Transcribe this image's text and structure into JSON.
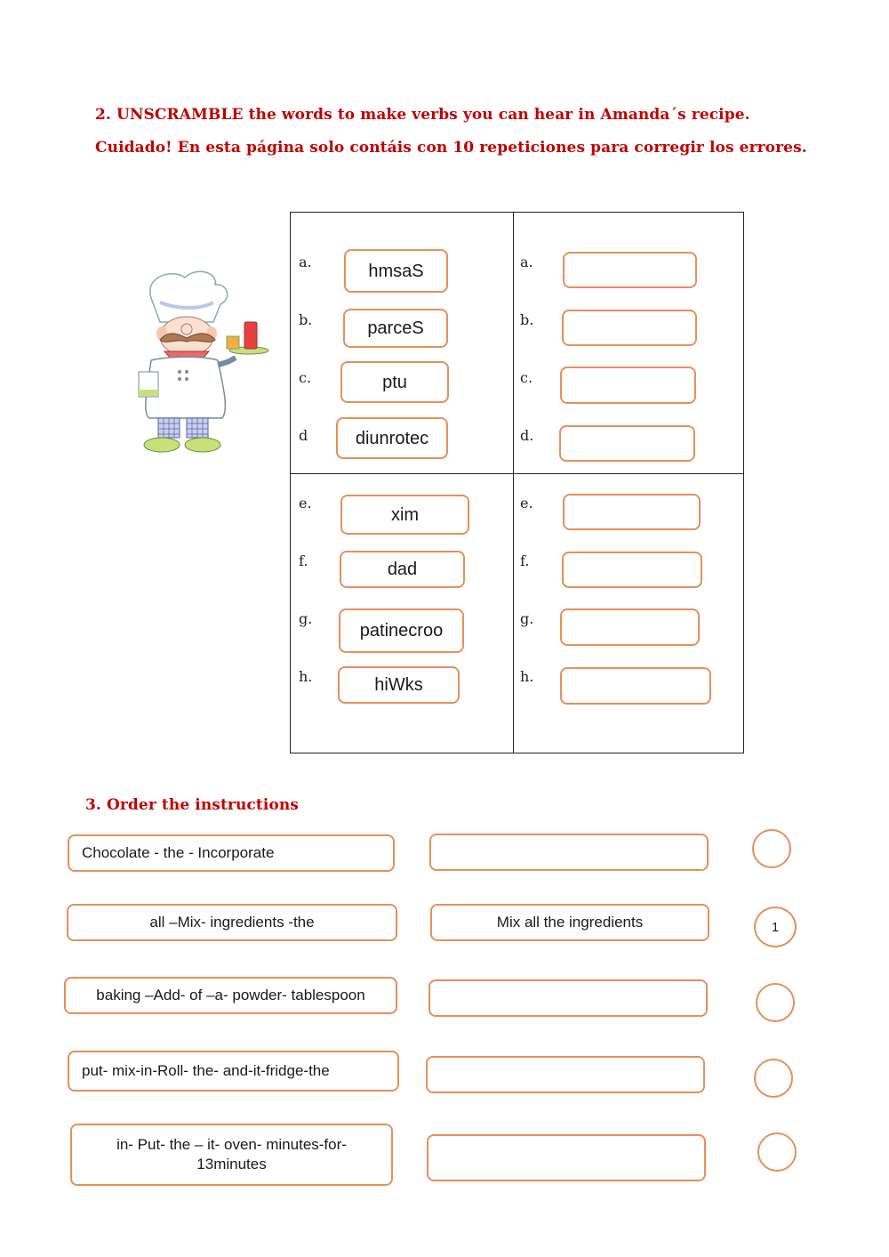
{
  "section2": {
    "title": "2. UNSCRAMBLE the words to make verbs you can hear in Amanda´s recipe.",
    "warning": "Cuidado! En esta página solo contáis con 10 repeticiones para corregir los errores.",
    "illustration": "chef-illustration",
    "scrambled": [
      {
        "label": "a.",
        "word": "hmsaS"
      },
      {
        "label": "b.",
        "word": "parceS"
      },
      {
        "label": "c.",
        "word": "ptu"
      },
      {
        "label": "d",
        "word": "diunrotec"
      },
      {
        "label": "e.",
        "word": "xim"
      },
      {
        "label": "f.",
        "word": "dad"
      },
      {
        "label": "g.",
        "word": "patinecroo"
      },
      {
        "label": "h.",
        "word": "hiWks"
      }
    ],
    "answers": [
      {
        "label": "a.",
        "value": ""
      },
      {
        "label": "b.",
        "value": ""
      },
      {
        "label": "c.",
        "value": ""
      },
      {
        "label": "d.",
        "value": ""
      },
      {
        "label": "e.",
        "value": ""
      },
      {
        "label": "f.",
        "value": ""
      },
      {
        "label": "g.",
        "value": ""
      },
      {
        "label": "h.",
        "value": ""
      }
    ]
  },
  "section3": {
    "title": "3. Order the instructions",
    "rows": [
      {
        "scrambled": "Chocolate - the - Incorporate",
        "answer": "",
        "order": ""
      },
      {
        "scrambled": "all –Mix- ingredients -the",
        "answer": "Mix all the ingredients",
        "order": "1"
      },
      {
        "scrambled": "baking –Add- of –a- powder- tablespoon",
        "answer": "",
        "order": ""
      },
      {
        "scrambled": "put- mix-in-Roll- the- and-it-fridge-the",
        "answer": "",
        "order": ""
      },
      {
        "scrambled": "in- Put- the – it- oven- minutes-for- 13minutes",
        "answer": "",
        "order": ""
      }
    ]
  },
  "colors": {
    "heading": "#c00000",
    "box_border": "#e4915a",
    "table_border": "#222222"
  }
}
